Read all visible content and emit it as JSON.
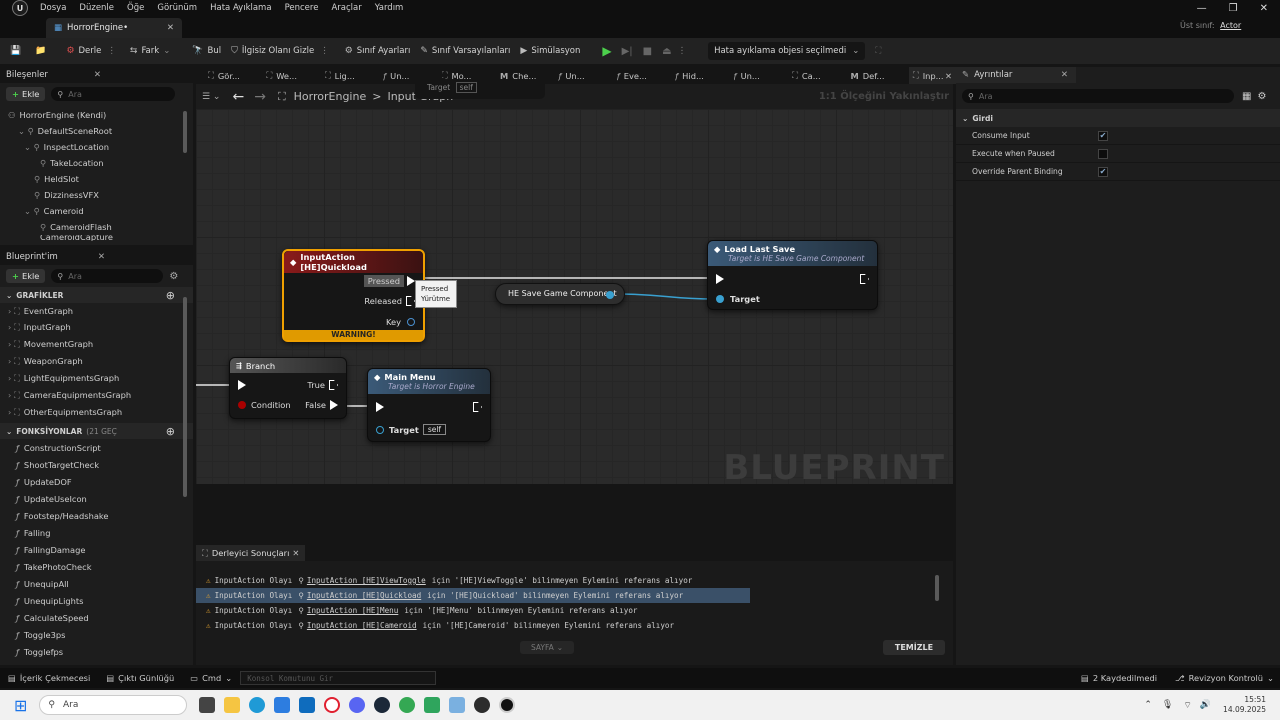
{
  "menu": {
    "items": [
      "Dosya",
      "Düzenle",
      "Öğe",
      "Görünüm",
      "Hata Ayıklama",
      "Pencere",
      "Araçlar",
      "Yardım"
    ]
  },
  "window": {
    "tab_title": "HorrorEngine•",
    "parent_class_label": "Üst sınıf:",
    "parent_class_value": "Actor"
  },
  "toolbar": {
    "compile": "Derle",
    "diff": "Fark",
    "find": "Bul",
    "hide_unrelated": "İlgisiz Olanı Gizle",
    "class_settings": "Sınıf Ayarları",
    "class_defaults": "Sınıf Varsayılanları",
    "simulation": "Simülasyon",
    "debug_object": "Hata ayıklama objesi seçilmedi"
  },
  "components": {
    "title": "Bileşenler",
    "add": "Ekle",
    "search_placeholder": "Ara",
    "items": [
      "HorrorEngine (Kendi)",
      "DefaultSceneRoot",
      "InspectLocation",
      "TakeLocation",
      "HeldSlot",
      "DizzinessVFX",
      "Cameroid",
      "CameroidFlash",
      "CameroidCapture"
    ]
  },
  "myblueprint": {
    "title": "Blueprint'im",
    "add": "Ekle",
    "search_placeholder": "Ara",
    "graphs_header": "GRAFİKLER",
    "graphs": [
      "EventGraph",
      "InputGraph",
      "MovementGraph",
      "WeaponGraph",
      "LightEquipmentsGraph",
      "CameraEquipmentsGraph",
      "OtherEquipmentsGraph"
    ],
    "functions_header": "FONKSİYONLAR",
    "functions_count": "(21 GEÇ",
    "functions": [
      "ConstructionScript",
      "ShootTargetCheck",
      "UpdateDOF",
      "UpdateUseIcon",
      "Footstep/Headshake",
      "Falling",
      "FallingDamage",
      "TakePhotoCheck",
      "UnequipAll",
      "UnequipLights",
      "CalculateSpeed",
      "Toggle3ps",
      "Togglefps"
    ]
  },
  "graph_tabs": [
    "Gör...",
    "We...",
    "Lig...",
    "Un...",
    "Mo...",
    "Che...",
    "Un...",
    "Eve...",
    "Hid...",
    "Un...",
    "Ca...",
    "Def...",
    "Inp..."
  ],
  "graph": {
    "breadcrumb_root": "HorrorEngine",
    "breadcrumb_sep": ">",
    "breadcrumb_current": "Input Graph",
    "zoom_label": "1:1 Ölçeğini Yakınlaştır",
    "watermark": "BLUEPRINT",
    "floating_target": "Target",
    "floating_self": "self",
    "input_node": {
      "title": "InputAction [HE]Quickload",
      "pressed": "Pressed",
      "released": "Released",
      "key": "Key",
      "warning": "WARNING!"
    },
    "tooltip": {
      "line1": "Pressed",
      "line2": "Yürütme"
    },
    "component_node": {
      "title": "HE Save Game Component"
    },
    "load_node": {
      "title": "Load Last Save",
      "subtitle": "Target is HE Save Game Component",
      "target": "Target"
    },
    "branch_node": {
      "title": "Branch",
      "true": "True",
      "false": "False",
      "condition": "Condition"
    },
    "menu_node": {
      "title": "Main Menu",
      "subtitle": "Target is Horror Engine",
      "target": "Target",
      "self": "self"
    }
  },
  "details": {
    "title": "Ayrıntılar",
    "search_placeholder": "Ara",
    "section": "Girdi",
    "rows": [
      {
        "label": "Consume Input",
        "checked": "✔"
      },
      {
        "label": "Execute when Paused",
        "checked": ""
      },
      {
        "label": "Override Parent Binding",
        "checked": "✔"
      }
    ]
  },
  "compiler": {
    "title": "Derleyici Sonuçları",
    "lines": [
      {
        "prefix": "InputAction Olayı",
        "link": "InputAction [HE]ViewToggle",
        "rest": "için '[HE]ViewToggle' bilinmeyen Eylemini referans alıyor"
      },
      {
        "prefix": "InputAction Olayı",
        "link": "InputAction [HE]Quickload",
        "rest": "için '[HE]Quickload' bilinmeyen Eylemini referans alıyor"
      },
      {
        "prefix": "InputAction Olayı",
        "link": "InputAction [HE]Menu",
        "rest": "için '[HE]Menu' bilinmeyen Eylemini referans alıyor"
      },
      {
        "prefix": "InputAction Olayı",
        "link": "InputAction [HE]Cameroid",
        "rest": "için '[HE]Cameroid' bilinmeyen Eylemini referans alıyor"
      }
    ],
    "page_label": "SAYFA",
    "clear": "TEMİZLE"
  },
  "statusbar": {
    "content_drawer": "İçerik Çekmecesi",
    "output_log": "Çıktı Günlüğü",
    "cmd": "Cmd",
    "console_placeholder": "Konsol Komutunu Gir",
    "unsaved": "2 Kaydedilmedi",
    "revision": "Revizyon Kontrolü"
  },
  "taskbar": {
    "search": "Ara",
    "time": "15:51",
    "date": "14.09.2025"
  },
  "colors": {
    "input_node_border": "#f0a000",
    "input_head": "#8a1a1a",
    "func_head": "#3b5a78",
    "accent": "#2a7ae0"
  }
}
